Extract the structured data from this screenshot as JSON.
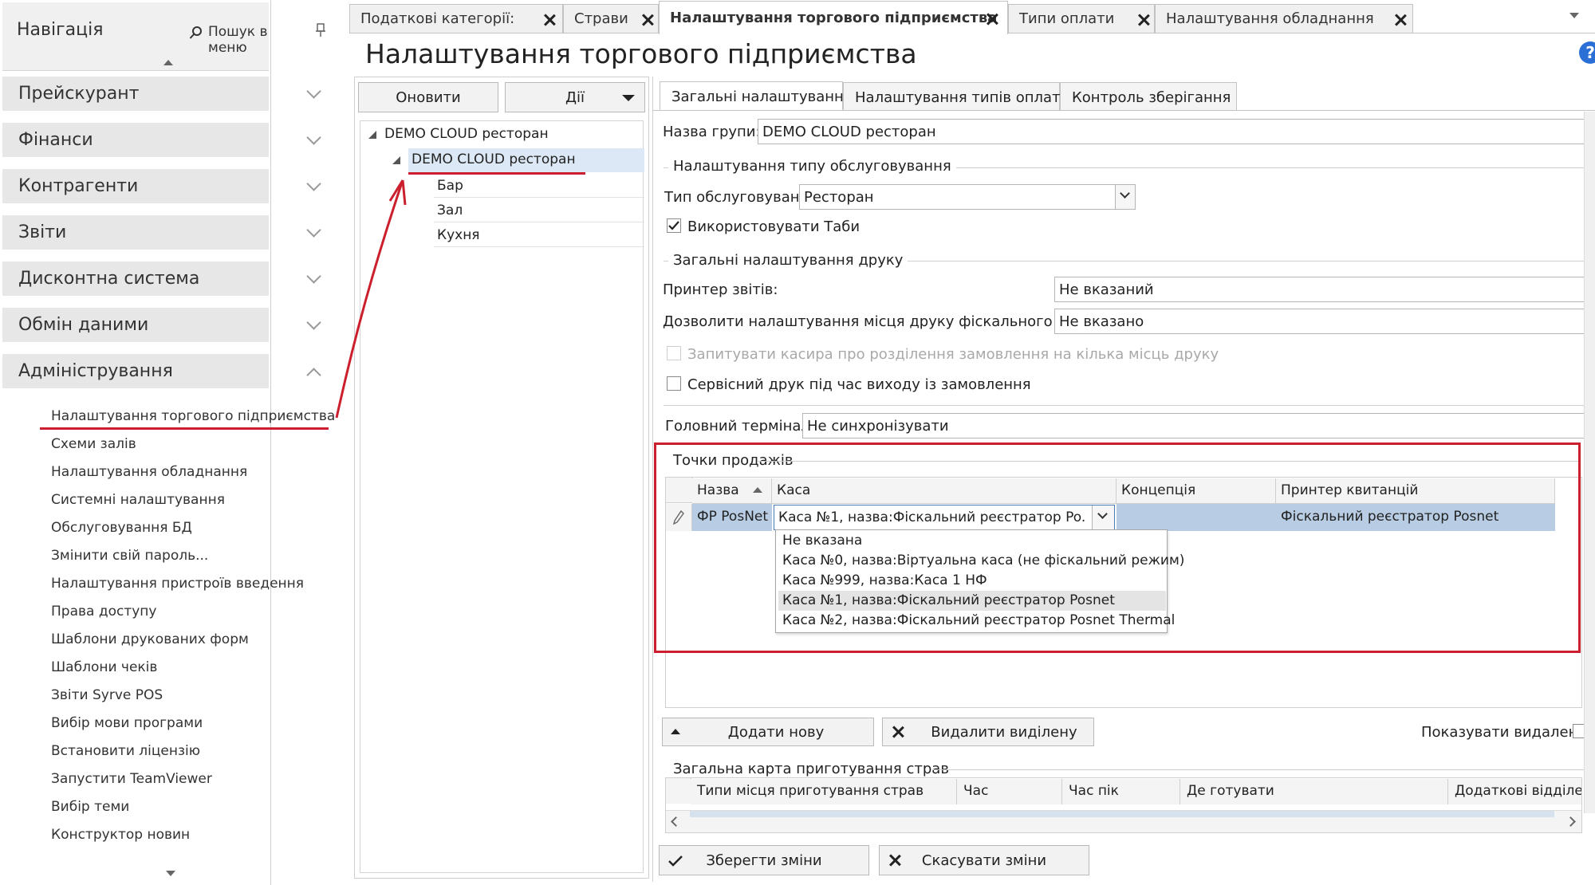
{
  "nav": {
    "title": "Навігація",
    "search_label": "Пошук в меню",
    "sections": [
      {
        "label": "Прейскурант"
      },
      {
        "label": "Фінанси"
      },
      {
        "label": "Контрагенти"
      },
      {
        "label": "Звіти"
      },
      {
        "label": "Дисконтна система"
      },
      {
        "label": "Обмін даними"
      },
      {
        "label": "Адміністрування"
      }
    ],
    "admin_items": [
      {
        "label": "Налаштування торгового підприємства"
      },
      {
        "label": "Схеми залів"
      },
      {
        "label": "Налаштування обладнання"
      },
      {
        "label": "Системні налаштування"
      },
      {
        "label": "Обслуговування БД"
      },
      {
        "label": "Змінити свій пароль..."
      },
      {
        "label": "Налаштування пристроїв введення"
      },
      {
        "label": "Права доступу"
      },
      {
        "label": "Шаблони друкованих форм"
      },
      {
        "label": "Шаблони чеків"
      },
      {
        "label": "Звіти Syrve POS"
      },
      {
        "label": "Вибір мови програми"
      },
      {
        "label": "Встановити ліцензію"
      },
      {
        "label": "Запустити TeamViewer"
      },
      {
        "label": "Вибір теми"
      },
      {
        "label": "Конструктор новин"
      }
    ]
  },
  "tabs": [
    {
      "label": "Податкові категорії:"
    },
    {
      "label": "Страви"
    },
    {
      "label": "Налаштування торгового підприємства"
    },
    {
      "label": "Типи оплати"
    },
    {
      "label": "Налаштування обладнання"
    }
  ],
  "page_title": "Налаштування торгового підприємства",
  "tree": {
    "refresh_label": "Оновити",
    "actions_label": "Дії",
    "nodes": [
      {
        "label": "DEMO CLOUD ресторан"
      },
      {
        "label": "DEMO CLOUD ресторан"
      },
      {
        "label": "Бар"
      },
      {
        "label": "Зал"
      },
      {
        "label": "Кухня"
      }
    ]
  },
  "subtabs": [
    {
      "label": "Загальні налаштування"
    },
    {
      "label": "Налаштування типів оплати"
    },
    {
      "label": "Контроль зберігання"
    }
  ],
  "form": {
    "group_name_label": "Назва групи:",
    "group_name_value": "DEMO CLOUD ресторан",
    "service_group_title": "Налаштування типу обслуговування",
    "service_type_label": "Тип обслуговування:",
    "service_type_value": "Ресторан",
    "use_tabs_label": "Використовувати Таби",
    "print_group_title": "Загальні налаштування друку",
    "report_printer_label": "Принтер звітів:",
    "report_printer_value": "Не вказаний",
    "fiscal_place_label": "Дозволити налаштування місця друку фіскального чека:",
    "fiscal_place_value": "Не вказано",
    "ask_cashier_label": "Запитувати касира про розділення замовлення на кілька місць друку",
    "service_print_label": "Сервісний друк під час виходу із замовлення",
    "main_terminal_label": "Головний термінал:",
    "main_terminal_value": "Не синхронізувати"
  },
  "pos": {
    "title": "Точки продажів",
    "columns": [
      "Назва",
      "Каса",
      "Концепція",
      "Принтер квитанцій"
    ],
    "row": {
      "name": "ФР PosNet",
      "cash": "Каса №1, назва:Фіскальний реєстратор Po...",
      "concept": "",
      "printer": "Фіскальний реєстратор Posnet"
    },
    "dropdown_options": [
      {
        "label": "Не вказана"
      },
      {
        "label": "Каса №0, назва:Віртуальна каса (не фіскальний режим)"
      },
      {
        "label": "Каса №999, назва:Каса 1 НФ"
      },
      {
        "label": "Каса №1, назва:Фіскальний реєстратор Posnet"
      },
      {
        "label": "Каса №2, назва:Фіскальний реєстратор Posnet Thermal"
      }
    ],
    "add_label": "Додати нову",
    "delete_label": "Видалити виділену",
    "show_deleted_label": "Показувати видалені"
  },
  "cooking": {
    "title": "Загальна карта приготування страв",
    "columns": [
      "Типи місця приготування страв",
      "Час",
      "Час пік",
      "Де готувати",
      "Додаткові відділення"
    ]
  },
  "footer": {
    "save_label": "Зберегти зміни",
    "cancel_label": "Скасувати зміни"
  },
  "colors": {
    "highlight": "#cc1f2d",
    "selected_row": "#b8cde4",
    "nav_bg": "#e7e7e7"
  }
}
